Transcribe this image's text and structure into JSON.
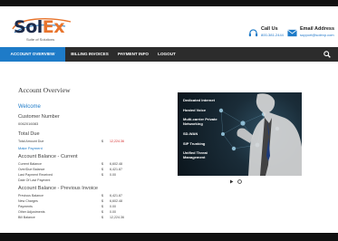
{
  "logo": {
    "name_s": "S",
    "name_ol": "ol",
    "name_ex": "Ex",
    "tagline": "Suite of Solutions"
  },
  "contact": {
    "call": {
      "label": "Call Us",
      "value": "800-381-2444",
      "icon": "headset-icon"
    },
    "email": {
      "label": "Email Address",
      "value": "support@solexp.com",
      "icon": "envelope-icon"
    }
  },
  "nav": {
    "items": [
      {
        "label": "ACCOUNT OVERVIEW",
        "active": true
      },
      {
        "label": "BILLING INVOICES",
        "active": false
      },
      {
        "label": "PAYMENT INFO",
        "active": false
      },
      {
        "label": "LOGOUT",
        "active": false
      }
    ],
    "search_icon": "search-icon"
  },
  "page": {
    "title": "Account Overview",
    "welcome": "Welcome"
  },
  "customer": {
    "heading": "Customer Number",
    "number": "0062016083"
  },
  "total_due": {
    "heading": "Total Due",
    "row": {
      "label": "Total Amount Due",
      "currency": "$",
      "amount": "12,224.36"
    },
    "make_payment": "Make Payment"
  },
  "balance_current": {
    "heading": "Account Balance - Current",
    "rows": [
      {
        "label": "Current Balance",
        "currency": "$",
        "amount": "6,602.48"
      },
      {
        "label": "Over/Due Balance",
        "currency": "$",
        "amount": "6,421.87"
      },
      {
        "label": "Last Payment Received",
        "currency": "$",
        "amount": "0.00"
      },
      {
        "label": "Date Of Last Payment",
        "currency": "",
        "amount": ""
      }
    ]
  },
  "balance_previous": {
    "heading": "Account Balance - Previous Invoice",
    "rows": [
      {
        "label": "Previous Balance",
        "currency": "$",
        "amount": "6,421.87"
      },
      {
        "label": "New Charges",
        "currency": "$",
        "amount": "6,602.48"
      },
      {
        "label": "Payments",
        "currency": "$",
        "amount": "0.00"
      },
      {
        "label": "Other Adjustments",
        "currency": "$",
        "amount": "0.00"
      },
      {
        "label": "Bill Balance",
        "currency": "$",
        "amount": "12,224.36"
      }
    ]
  },
  "promo": {
    "items": [
      "Dedicated Internet",
      "Hosted Voice",
      "Multi-carrier Private Networking",
      "SD-WAN",
      "SIP Trunking",
      "Unified Threat Management"
    ]
  },
  "carousel": {
    "play_icon": "play-icon",
    "pause_icon": "pause-icon"
  },
  "colors": {
    "accent": "#1e7bc8",
    "navbar": "#2c2c2c",
    "alert_red": "#d52b2b",
    "brand_orange": "#e8742c",
    "brand_navy": "#1c2a4a"
  }
}
